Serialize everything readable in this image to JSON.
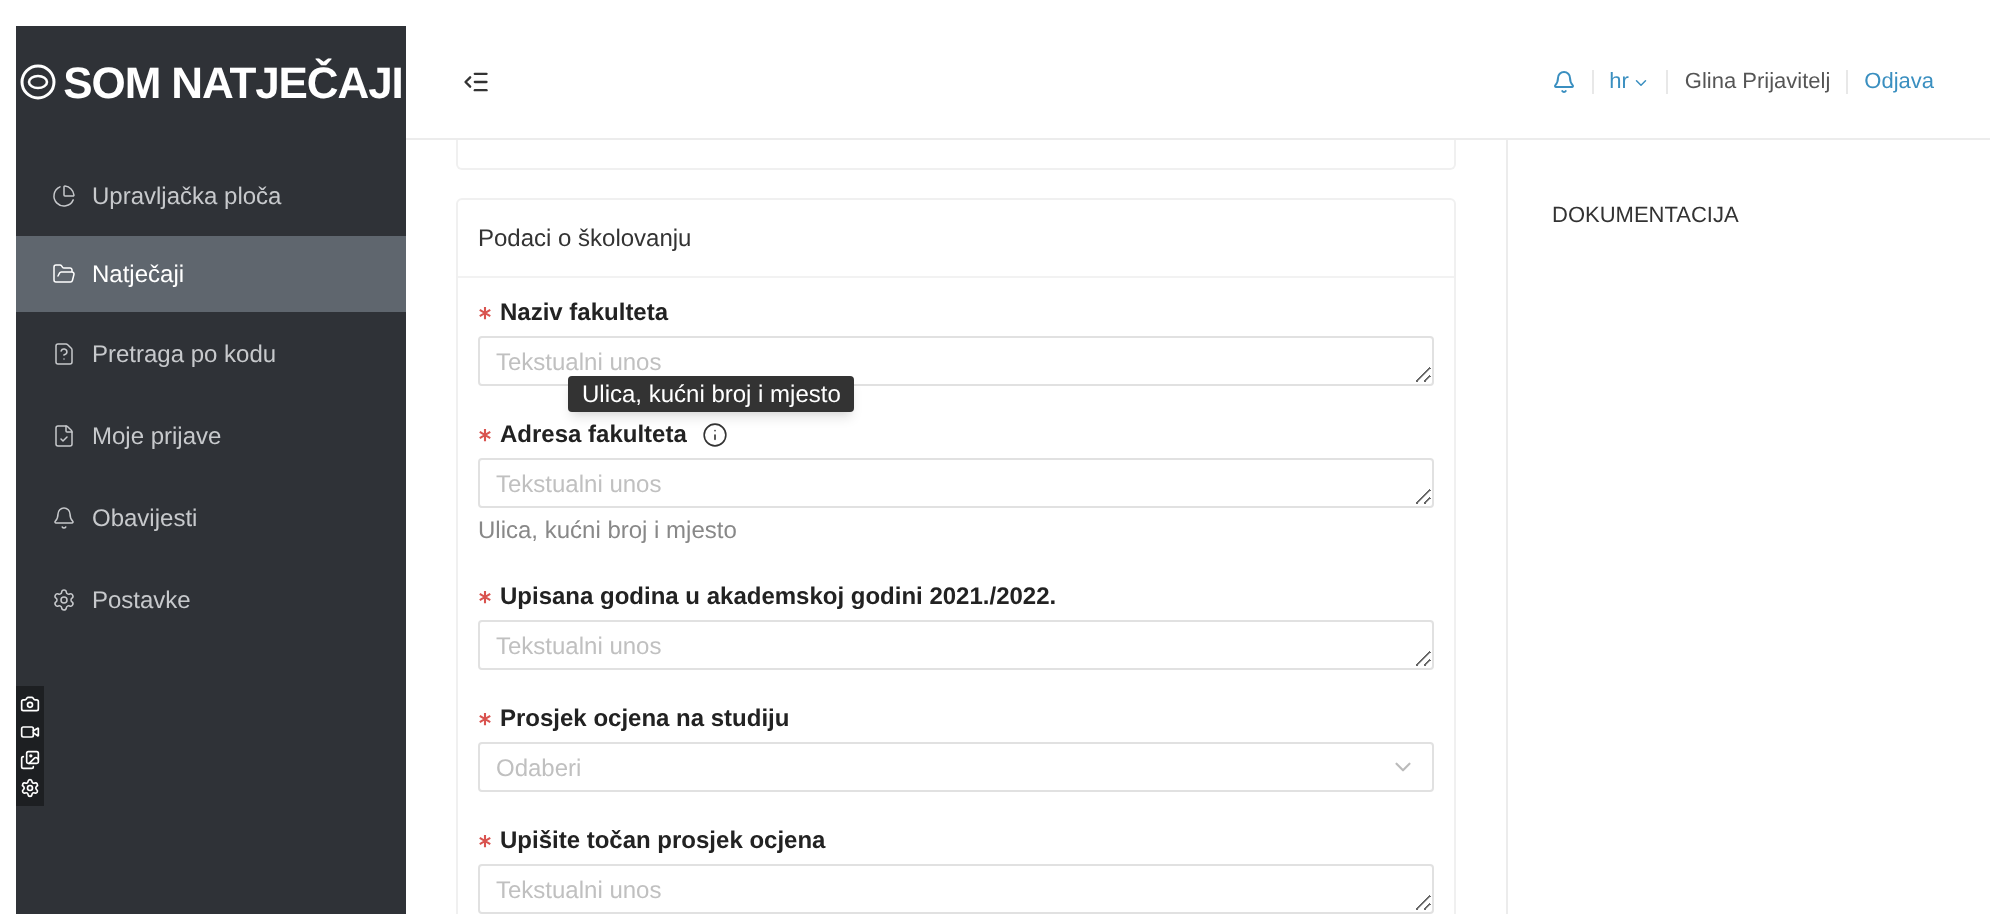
{
  "logo": {
    "text": "SOM NATJEČAJI"
  },
  "sidebar": {
    "items": [
      {
        "label": "Upravljačka ploča",
        "selected": false
      },
      {
        "label": "Natječaji",
        "selected": true
      },
      {
        "label": "Pretraga po kodu",
        "selected": false
      },
      {
        "label": "Moje prijave",
        "selected": false
      },
      {
        "label": "Obavijesti",
        "selected": false
      },
      {
        "label": "Postavke",
        "selected": false
      }
    ]
  },
  "header": {
    "language": "hr",
    "user": "Glina Prijavitelj",
    "logout": "Odjava"
  },
  "form": {
    "title": "Podaci o školovanju",
    "fields": [
      {
        "kind": "textarea",
        "label": "Naziv fakulteta",
        "required": true,
        "placeholder": "Tekstualni unos"
      },
      {
        "kind": "textarea",
        "label": "Adresa fakulteta",
        "required": true,
        "info": true,
        "placeholder": "Tekstualni unos",
        "help": "Ulica, kućni broj i mjesto",
        "tooltip": "Ulica, kućni broj i mjesto"
      },
      {
        "kind": "textarea",
        "label": "Upisana godina u akademskoj godini 2021./2022.",
        "required": true,
        "placeholder": "Tekstualni unos"
      },
      {
        "kind": "select",
        "label": "Prosjek ocjena na studiju",
        "required": true,
        "placeholder": "Odaberi"
      },
      {
        "kind": "textarea",
        "label": "Upišite točan prosjek ocjena",
        "required": true,
        "placeholder": "Tekstualni unos"
      }
    ]
  },
  "right_panel": {
    "title": "DOKUMENTACIJA"
  }
}
